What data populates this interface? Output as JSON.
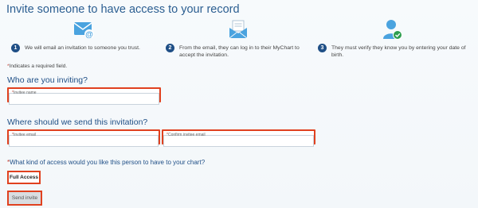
{
  "page": {
    "title": "Invite someone to have access to your record"
  },
  "steps": [
    {
      "number": "1",
      "text": "We will email an invitation to someone you trust.",
      "icon": "email-at-icon"
    },
    {
      "number": "2",
      "text": "From the email, they can log in to their MyChart to accept the invitation.",
      "icon": "open-envelope-icon"
    },
    {
      "number": "3",
      "text": "They must verify they know you by entering your date of birth.",
      "icon": "user-check-icon"
    }
  ],
  "required_note": {
    "star": "*",
    "text": "Indicates a required field."
  },
  "who_section": {
    "heading": "Who are you inviting?",
    "invitee_name_label": "Invitee name",
    "invitee_name_value": ""
  },
  "where_section": {
    "heading": "Where should we send this invitation?",
    "invitee_email_label": "Invitee email",
    "invitee_email_value": "",
    "confirm_email_label": "Confirm invitee email",
    "confirm_email_value": ""
  },
  "access_section": {
    "heading": "What kind of access would you like this person to have to your chart?",
    "option_label": "Full Access"
  },
  "send_button": {
    "label": "Send invite"
  },
  "colors": {
    "accent": "#1f4f86",
    "highlight_border": "#e0411f",
    "required_star": "#c0392b"
  }
}
